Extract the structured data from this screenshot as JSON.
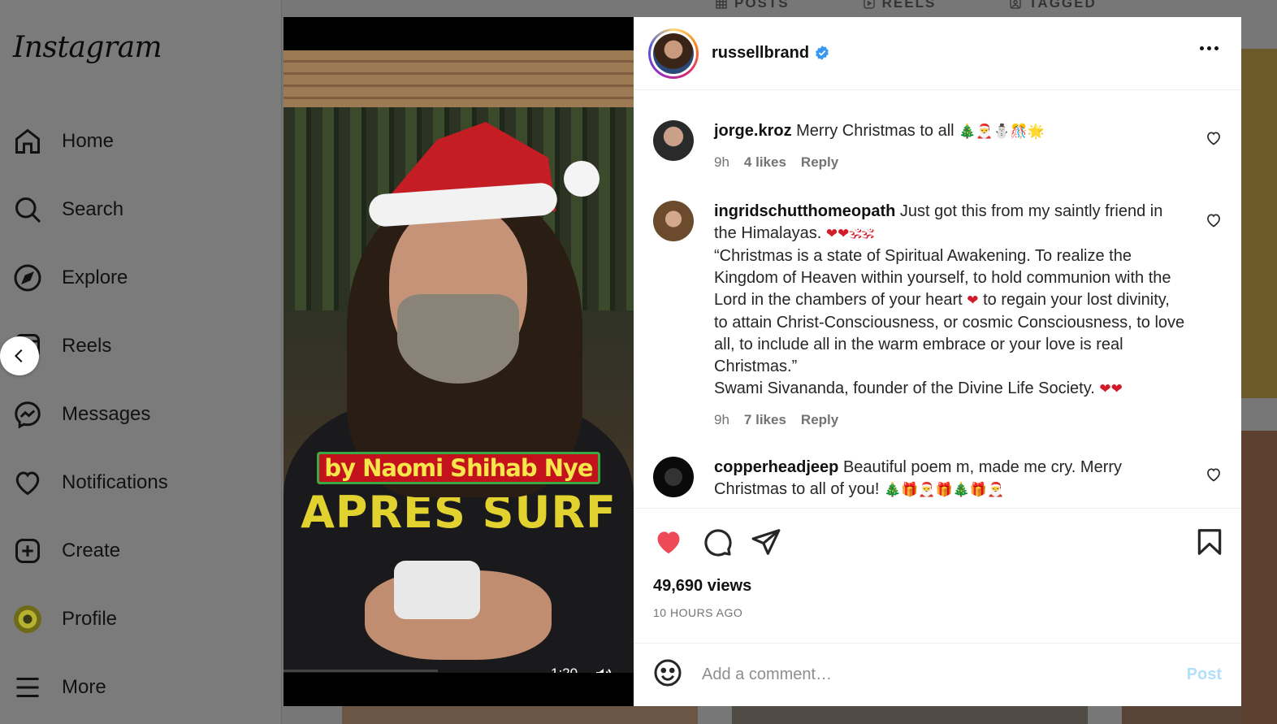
{
  "app": {
    "logo": "Instagram"
  },
  "sidebar": {
    "items": [
      {
        "label": "Home",
        "icon": "home-icon"
      },
      {
        "label": "Search",
        "icon": "search-icon"
      },
      {
        "label": "Explore",
        "icon": "compass-icon"
      },
      {
        "label": "Reels",
        "icon": "reels-icon"
      },
      {
        "label": "Messages",
        "icon": "messenger-icon"
      },
      {
        "label": "Notifications",
        "icon": "heart-icon"
      },
      {
        "label": "Create",
        "icon": "plus-square-icon"
      },
      {
        "label": "Profile",
        "icon": "avatar"
      },
      {
        "label": "More",
        "icon": "menu-icon"
      }
    ]
  },
  "background_tabs": [
    "POSTS",
    "REELS",
    "TAGGED"
  ],
  "video": {
    "overlay_caption": "by Naomi Shihab Nye",
    "shirt_print": "APRES SURF",
    "time": "1:20",
    "progress": 0.4
  },
  "post": {
    "username": "russellbrand",
    "verified": true,
    "views": "49,690 views",
    "time_ago": "10 HOURS AGO"
  },
  "comments": [
    {
      "user": "jorge.kroz",
      "text": "Merry Christmas to all",
      "emoji": "🎄🎅⛄🎊🌟",
      "time": "9h",
      "likes": "4 likes",
      "reply": "Reply"
    },
    {
      "user": "ingridschutthomeopath",
      "text": "Just got this from my saintly friend in the Himalayas.",
      "emoji": "❤❤🕉🕉",
      "text2": "“Christmas is a state of Spiritual Awakening. To realize the Kingdom of Heaven within yourself, to hold communion with the Lord in the chambers of your heart",
      "emoji2": "❤",
      "text3": "to regain your lost divinity, to attain Christ-Consciousness, or cosmic Consciousness, to love all, to include all in the warm embrace or your love is real Christmas.”",
      "text4": "Swami Sivananda, founder of the Divine Life Society.",
      "emoji4": "❤❤",
      "time": "9h",
      "likes": "7 likes",
      "reply": "Reply"
    },
    {
      "user": "copperheadjeep",
      "text": "Beautiful poem m, made me cry. Merry Christmas to all of you!",
      "emoji": "🎄🎁🎅🎁🎄🎁🎅"
    }
  ],
  "composer": {
    "placeholder": "Add a comment…",
    "post_label": "Post"
  },
  "colors": {
    "liked": "#ed4956",
    "link_blue": "#0095f6",
    "post_disabled": "#b2dffc",
    "verified": "#3897f0"
  }
}
